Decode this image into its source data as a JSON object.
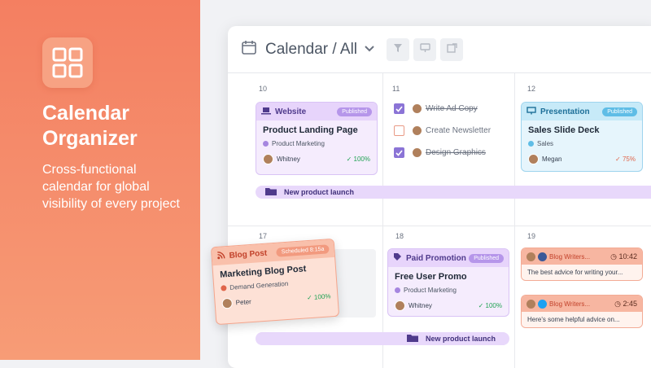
{
  "promo": {
    "title": "Calendar Organizer",
    "description": "Cross-functional calendar for global visibility of every project"
  },
  "toolbar": {
    "title": "Calendar / All"
  },
  "days": [
    "10",
    "11",
    "12",
    "17",
    "18",
    "19"
  ],
  "cards": {
    "website": {
      "category": "Website",
      "badge": "Published",
      "title": "Product Landing Page",
      "tag": "Product Marketing",
      "owner": "Whitney",
      "progress": "100%"
    },
    "presentation": {
      "category": "Presentation",
      "badge": "Published",
      "title": "Sales Slide Deck",
      "tag": "Sales",
      "owner": "Megan",
      "progress": "75%"
    },
    "blog": {
      "category": "Blog Post",
      "badge": "Scheduled 8:15a",
      "title": "Marketing Blog Post",
      "tag": "Demand Generation",
      "owner": "Peter",
      "progress": "100%"
    },
    "paid": {
      "category": "Paid Promotion",
      "badge": "Published",
      "title": "Free User Promo",
      "tag": "Product Marketing",
      "owner": "Whitney",
      "progress": "100%"
    }
  },
  "tasks": [
    {
      "label": "Write Ad Copy",
      "done": true
    },
    {
      "label": "Create Newsletter",
      "done": false
    },
    {
      "label": "Design Graphics",
      "done": true
    }
  ],
  "launch_label": "New product launch",
  "social": [
    {
      "account": "Blog Writers...",
      "time": "10:42",
      "text": "The best advice for writing your..."
    },
    {
      "account": "Blog Writers...",
      "time": "2:45",
      "text": "Here's some helpful advice on..."
    }
  ],
  "colors": {
    "promo": "#f58d6c",
    "purple": "#8b74d6",
    "blue": "#5fbde6",
    "orange": "#f29a7f"
  }
}
